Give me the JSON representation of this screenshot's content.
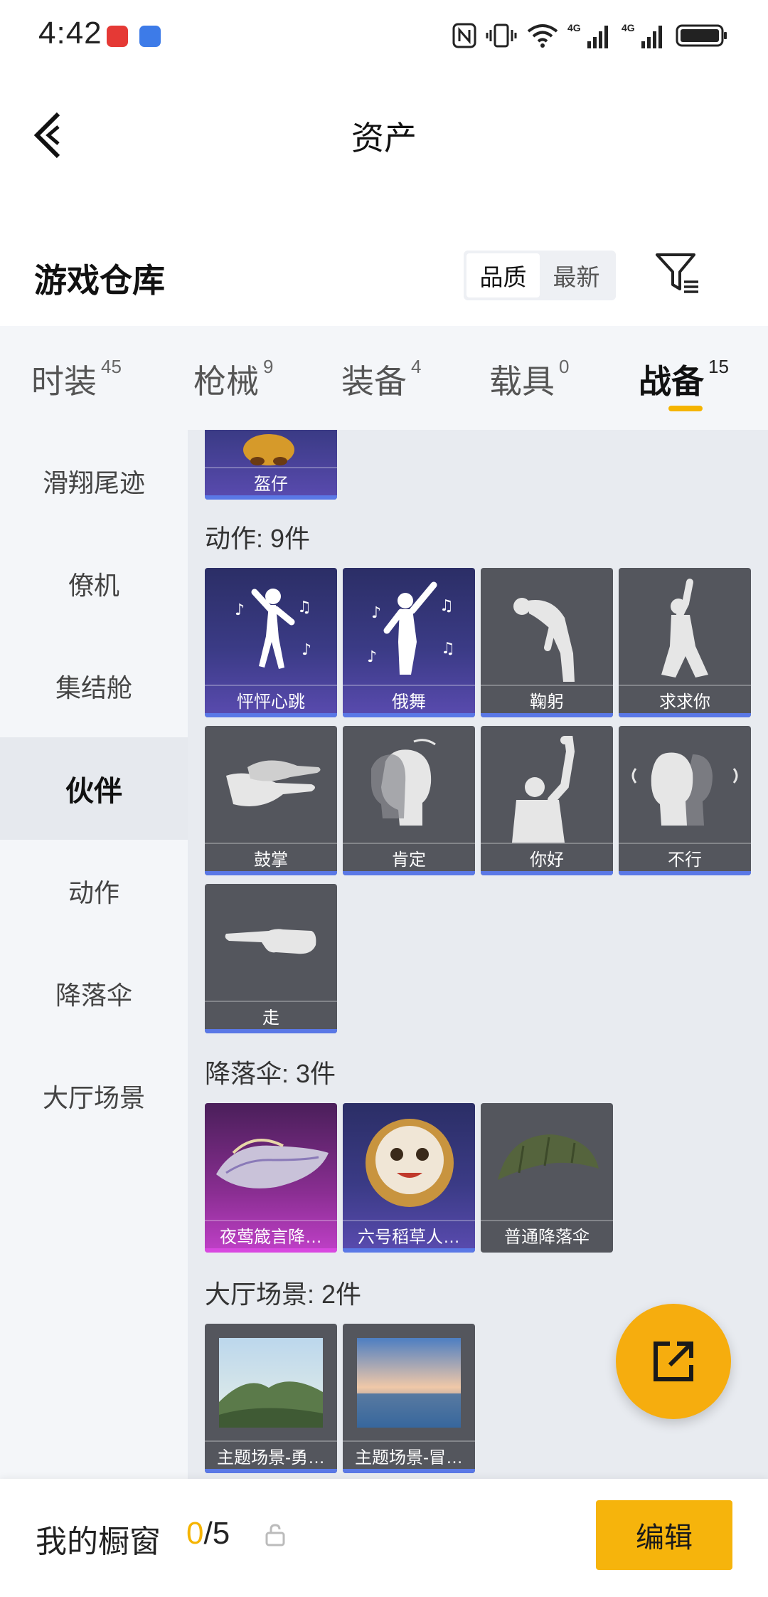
{
  "status_bar": {
    "time": "4:42",
    "icons": [
      "huawei-app-icon",
      "signal-app-icon",
      "nfc-icon",
      "vibrate-icon",
      "wifi-icon",
      "4g-signal-icon",
      "4g-signal-icon",
      "battery-icon"
    ],
    "network1": "4G",
    "network2": "4G"
  },
  "header": {
    "title": "资产",
    "back_icon": "chevron-left-icon"
  },
  "warehouse": {
    "title": "游戏仓库",
    "sort_options": [
      "品质",
      "最新"
    ],
    "sort_selected": "品质",
    "filter_icon": "filter-icon"
  },
  "tabs": [
    {
      "label": "时装",
      "count": "45",
      "active": false
    },
    {
      "label": "枪械",
      "count": "9",
      "active": false
    },
    {
      "label": "装备",
      "count": "4",
      "active": false
    },
    {
      "label": "载具",
      "count": "0",
      "active": false
    },
    {
      "label": "战备",
      "count": "15",
      "active": true
    }
  ],
  "side_nav": [
    {
      "label": "滑翔尾迹",
      "active": false
    },
    {
      "label": "僚机",
      "active": false
    },
    {
      "label": "集结舱",
      "active": false
    },
    {
      "label": "伙伴",
      "active": true
    },
    {
      "label": "动作",
      "active": false
    },
    {
      "label": "降落伞",
      "active": false
    },
    {
      "label": "大厅场景",
      "active": false
    }
  ],
  "content": {
    "partial_top_item": {
      "name": "盔仔",
      "style": "purple"
    },
    "sections": [
      {
        "title": "动作: 9件",
        "items": [
          {
            "name": "怦怦心跳",
            "style": "purple"
          },
          {
            "name": "俄舞",
            "style": "purple"
          },
          {
            "name": "鞠躬",
            "style": "grey"
          },
          {
            "name": "求求你",
            "style": "grey"
          },
          {
            "name": "鼓掌",
            "style": "grey"
          },
          {
            "name": "肯定",
            "style": "grey"
          },
          {
            "name": "你好",
            "style": "grey"
          },
          {
            "name": "不行",
            "style": "grey"
          },
          {
            "name": "走",
            "style": "grey"
          }
        ]
      },
      {
        "title": "降落伞: 3件",
        "items": [
          {
            "name": "夜莺箴言降…",
            "style": "pink"
          },
          {
            "name": "六号稻草人…",
            "style": "purple"
          },
          {
            "name": "普通降落伞",
            "style": "grey"
          }
        ]
      },
      {
        "title": "大厅场景: 2件",
        "items": [
          {
            "name": "主题场景-勇…",
            "style": "grey"
          },
          {
            "name": "主题场景-冒…",
            "style": "grey"
          }
        ]
      }
    ]
  },
  "share_button": {
    "icon": "share-external-icon"
  },
  "showcase": {
    "label": "我的橱窗",
    "count_current": "0",
    "count_total": "/5",
    "lock_icon": "lock-icon",
    "edit_label": "编辑"
  },
  "colors": {
    "accent": "#f6b40c",
    "rarity_blue": "#5a78e6",
    "rarity_pink": "#d848e0"
  }
}
